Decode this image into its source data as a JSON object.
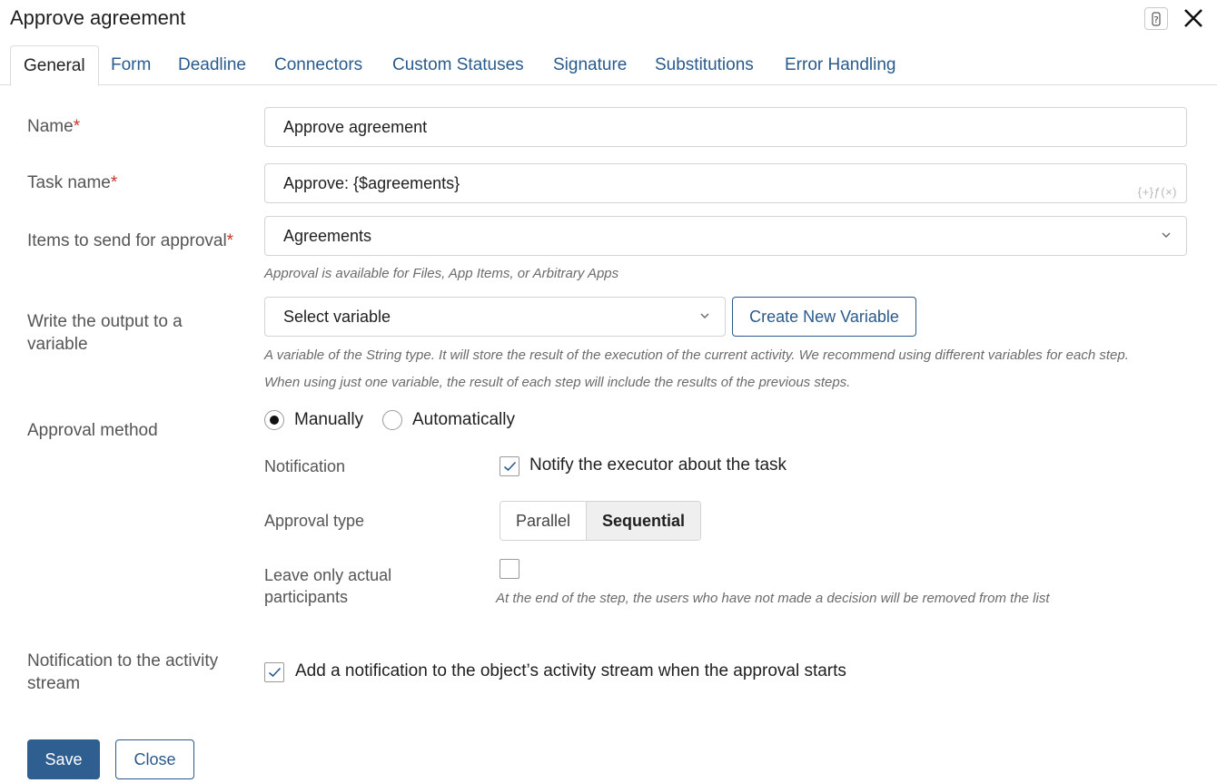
{
  "window": {
    "title": "Approve agreement",
    "help_icon": "question-icon",
    "close_icon": "close-icon"
  },
  "tabs": [
    {
      "label": "General",
      "active": true
    },
    {
      "label": "Form"
    },
    {
      "label": "Deadline"
    },
    {
      "label": "Connectors"
    },
    {
      "label": "Custom Statuses"
    },
    {
      "label": "Signature"
    },
    {
      "label": "Substitutions"
    },
    {
      "label": "Error Handling"
    }
  ],
  "form": {
    "name": {
      "label": "Name",
      "required_mark": "*",
      "value": "Approve agreement"
    },
    "task_name": {
      "label": "Task name",
      "required_mark": "*",
      "value": "Approve: {$agreements}",
      "fx_text": "{+}ƒ(×)"
    },
    "items": {
      "label": "Items to send for approval",
      "required_mark": "*",
      "value": "Agreements",
      "hint": "Approval is available for Files, App Items, or Arbitrary Apps"
    },
    "output": {
      "label_line1": "Write the output to a",
      "label_line2": "variable",
      "select_value": "Select variable",
      "create_button": "Create New Variable",
      "hint_line1": "A variable of the String type. It will store the result of the execution of the current activity. We recommend using different variables for each step.",
      "hint_line2": "When using just one variable, the result of each step will include the results of the previous steps."
    },
    "approval_method": {
      "label": "Approval method",
      "options": [
        {
          "label": "Manually",
          "selected": true
        },
        {
          "label": "Automatically",
          "selected": false
        }
      ]
    },
    "notification": {
      "label": "Notification",
      "checkbox_label": "Notify the executor about the task",
      "checked": true
    },
    "approval_type": {
      "label": "Approval type",
      "options": [
        "Parallel",
        "Sequential"
      ],
      "selected": "Sequential"
    },
    "leave_actual": {
      "label_line1": "Leave only actual",
      "label_line2": "participants",
      "checked": false,
      "hint": "At the end of the step, the users who have not made a decision will be removed from the list"
    },
    "activity_stream": {
      "label_line1": "Notification to the activity",
      "label_line2": "stream",
      "checkbox_label": "Add a notification to the object’s activity stream when the approval starts",
      "checked": true
    }
  },
  "footer": {
    "save": "Save",
    "close": "Close"
  },
  "colors": {
    "accent": "#2a5a8c",
    "primary_button": "#2f5f90",
    "required": "#c0392b"
  }
}
